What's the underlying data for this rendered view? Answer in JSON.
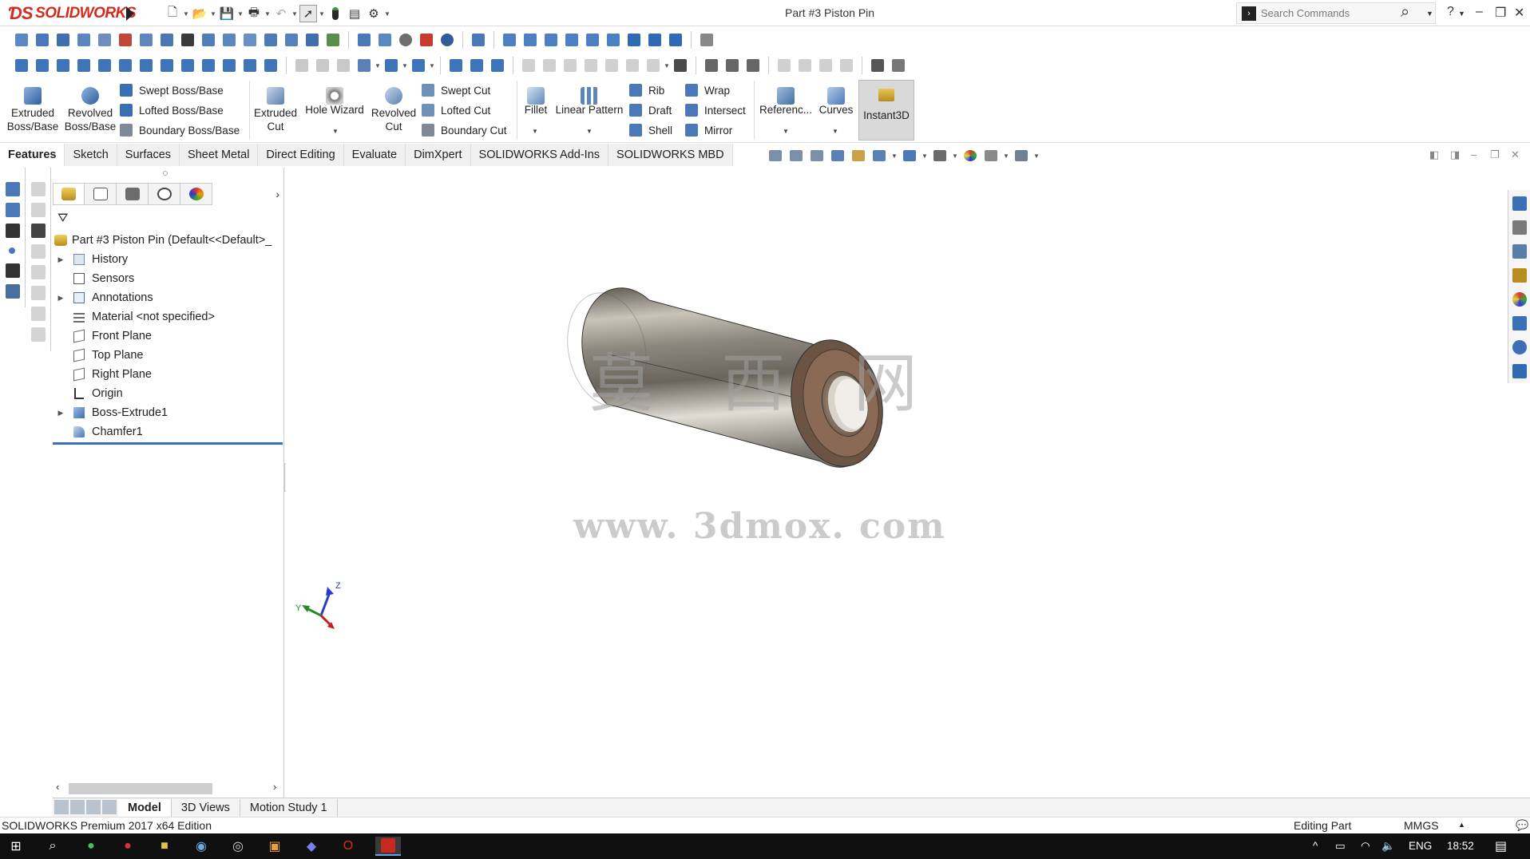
{
  "app": {
    "brand": "SOLIDWORKS",
    "document_title": "Part #3 Piston Pin",
    "search_placeholder": "Search Commands"
  },
  "quick_access": [
    "new-icon",
    "open-icon",
    "save-icon",
    "print-icon",
    "undo-icon",
    "select-icon",
    "rebuild-icon",
    "file-properties-icon",
    "options-icon"
  ],
  "command_manager": {
    "extruded_boss": "Extruded\nBoss/Base",
    "extruded_boss_l1": "Extruded",
    "extruded_boss_l2": "Boss/Base",
    "revolved_boss_l1": "Revolved",
    "revolved_boss_l2": "Boss/Base",
    "swept_boss": "Swept Boss/Base",
    "lofted_boss": "Lofted Boss/Base",
    "boundary_boss": "Boundary Boss/Base",
    "extruded_cut_l1": "Extruded",
    "extruded_cut_l2": "Cut",
    "hole_wizard": "Hole Wizard",
    "revolved_cut_l1": "Revolved",
    "revolved_cut_l2": "Cut",
    "swept_cut": "Swept Cut",
    "lofted_cut": "Lofted Cut",
    "boundary_cut": "Boundary Cut",
    "fillet": "Fillet",
    "linear_pattern": "Linear Pattern",
    "rib": "Rib",
    "draft": "Draft",
    "shell": "Shell",
    "wrap": "Wrap",
    "intersect": "Intersect",
    "mirror": "Mirror",
    "reference": "Referenc...",
    "curves": "Curves",
    "instant3d": "Instant3D"
  },
  "tabs": [
    "Features",
    "Sketch",
    "Surfaces",
    "Sheet Metal",
    "Direct Editing",
    "Evaluate",
    "DimXpert",
    "SOLIDWORKS Add-Ins",
    "SOLIDWORKS MBD"
  ],
  "feature_tree": {
    "root": "Part #3 Piston Pin  (Default<<Default>_",
    "items": [
      {
        "label": "History",
        "expandable": true,
        "icon": "history-folder-icon"
      },
      {
        "label": "Sensors",
        "expandable": false,
        "icon": "sensors-icon"
      },
      {
        "label": "Annotations",
        "expandable": true,
        "icon": "annotations-icon"
      },
      {
        "label": "Material <not specified>",
        "expandable": false,
        "icon": "material-icon"
      },
      {
        "label": "Front Plane",
        "expandable": false,
        "icon": "plane-icon"
      },
      {
        "label": "Top Plane",
        "expandable": false,
        "icon": "plane-icon"
      },
      {
        "label": "Right Plane",
        "expandable": false,
        "icon": "plane-icon"
      },
      {
        "label": "Origin",
        "expandable": false,
        "icon": "origin-icon"
      },
      {
        "label": "Boss-Extrude1",
        "expandable": true,
        "icon": "boss-extrude-icon"
      },
      {
        "label": "Chamfer1",
        "expandable": false,
        "icon": "chamfer-icon"
      }
    ]
  },
  "viewport": {
    "watermark_cn": "莫 西 网",
    "watermark_url": "www. 3dmox. com",
    "triad": {
      "z": "Z",
      "y": "Y"
    }
  },
  "bottom_tabs": [
    "Model",
    "3D Views",
    "Motion Study 1"
  ],
  "status": {
    "edition": "SOLIDWORKS Premium 2017 x64 Edition",
    "mode": "Editing Part",
    "units": "MMGS"
  },
  "taskbar": {
    "lang": "ENG",
    "time": "18:52"
  },
  "colors": {
    "brand_red": "#d52b1e",
    "rollback_bar": "#3d6fb6",
    "taskbar_bg": "#101010"
  }
}
